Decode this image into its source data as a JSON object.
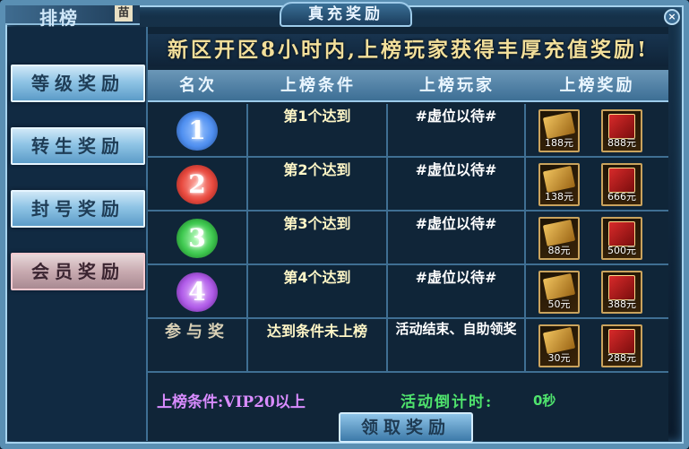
{
  "window": {
    "title": "真充奖励",
    "corner_text": "排榜",
    "corner_tag": "苗",
    "close_label": "×"
  },
  "sidebar": {
    "items": [
      {
        "label": "等级奖励",
        "active": false
      },
      {
        "label": "转生奖励",
        "active": false
      },
      {
        "label": "封号奖励",
        "active": false
      },
      {
        "label": "会员奖励",
        "active": true
      }
    ]
  },
  "banner": "新区开区8小时内,上榜玩家获得丰厚充值奖励!",
  "table": {
    "headers": [
      "名次",
      "上榜条件",
      "上榜玩家",
      "上榜奖励"
    ],
    "rows": [
      {
        "rank": "1",
        "condition": "第1个达到",
        "player": "#虚位以待#",
        "reward_a": "188元",
        "reward_b": "888元"
      },
      {
        "rank": "2",
        "condition": "第2个达到",
        "player": "#虚位以待#",
        "reward_a": "138元",
        "reward_b": "666元"
      },
      {
        "rank": "3",
        "condition": "第3个达到",
        "player": "#虚位以待#",
        "reward_a": "88元",
        "reward_b": "500元"
      },
      {
        "rank": "4",
        "condition": "第4个达到",
        "player": "#虚位以待#",
        "reward_a": "50元",
        "reward_b": "388元"
      },
      {
        "rank": "参与奖",
        "condition": "达到条件未上榜",
        "player": "活动结束、自助领奖",
        "reward_a": "30元",
        "reward_b": "288元"
      }
    ]
  },
  "footer": {
    "condition": "上榜条件:VIP20以上",
    "countdown_label": "活动倒计时:",
    "countdown_value": "0秒",
    "claim_label": "领取奖励"
  },
  "colors": {
    "rank1": "#4f8ff0",
    "rank2": "#e84a3f",
    "rank3": "#3ec84f",
    "rank4": "#b05be8"
  }
}
